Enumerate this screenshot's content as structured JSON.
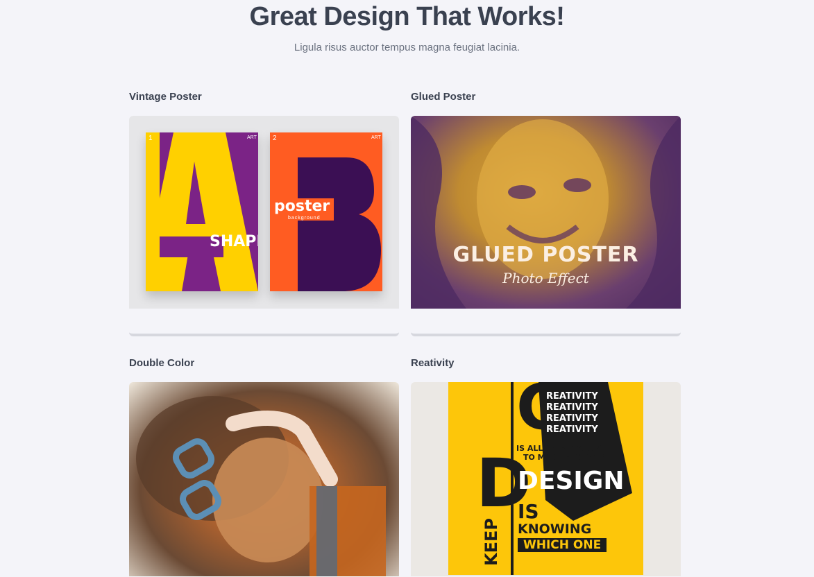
{
  "header": {
    "title": "Great Design That Works!",
    "subtitle": "Ligula risus auctor tempus magna feugiat lacinia."
  },
  "cards": [
    {
      "title": "Vintage Poster",
      "poster_a": {
        "letter": "A",
        "word": "SHAPE",
        "number": "1",
        "tag": "ART"
      },
      "poster_b": {
        "letter": "B",
        "word": "poster",
        "sub": "background",
        "number": "2",
        "tag": "ART"
      }
    },
    {
      "title": "Glued Poster",
      "headline": "GLUED POSTER",
      "script": "Photo Effect"
    },
    {
      "title": "Double Color"
    },
    {
      "title": "Reativity",
      "lines": [
        "REATIVITY",
        "REATIVITY",
        "REATIVITY",
        "REATIVITY"
      ],
      "allowing": "IS ALLOWING YOURSELF",
      "mistakes": "TO MAKE MISTAKES",
      "design": "DESIGN",
      "is": "IS",
      "knowing": "KNOWING",
      "which": "WHICH ONE",
      "keep": "KEEP",
      "big_c": "C",
      "big_d": "D"
    }
  ],
  "colors": {
    "background": "#f4f4f9",
    "heading": "#3a4150",
    "purple": "#7b2386",
    "orange": "#ff5c22",
    "yellow": "#fdc60a"
  }
}
